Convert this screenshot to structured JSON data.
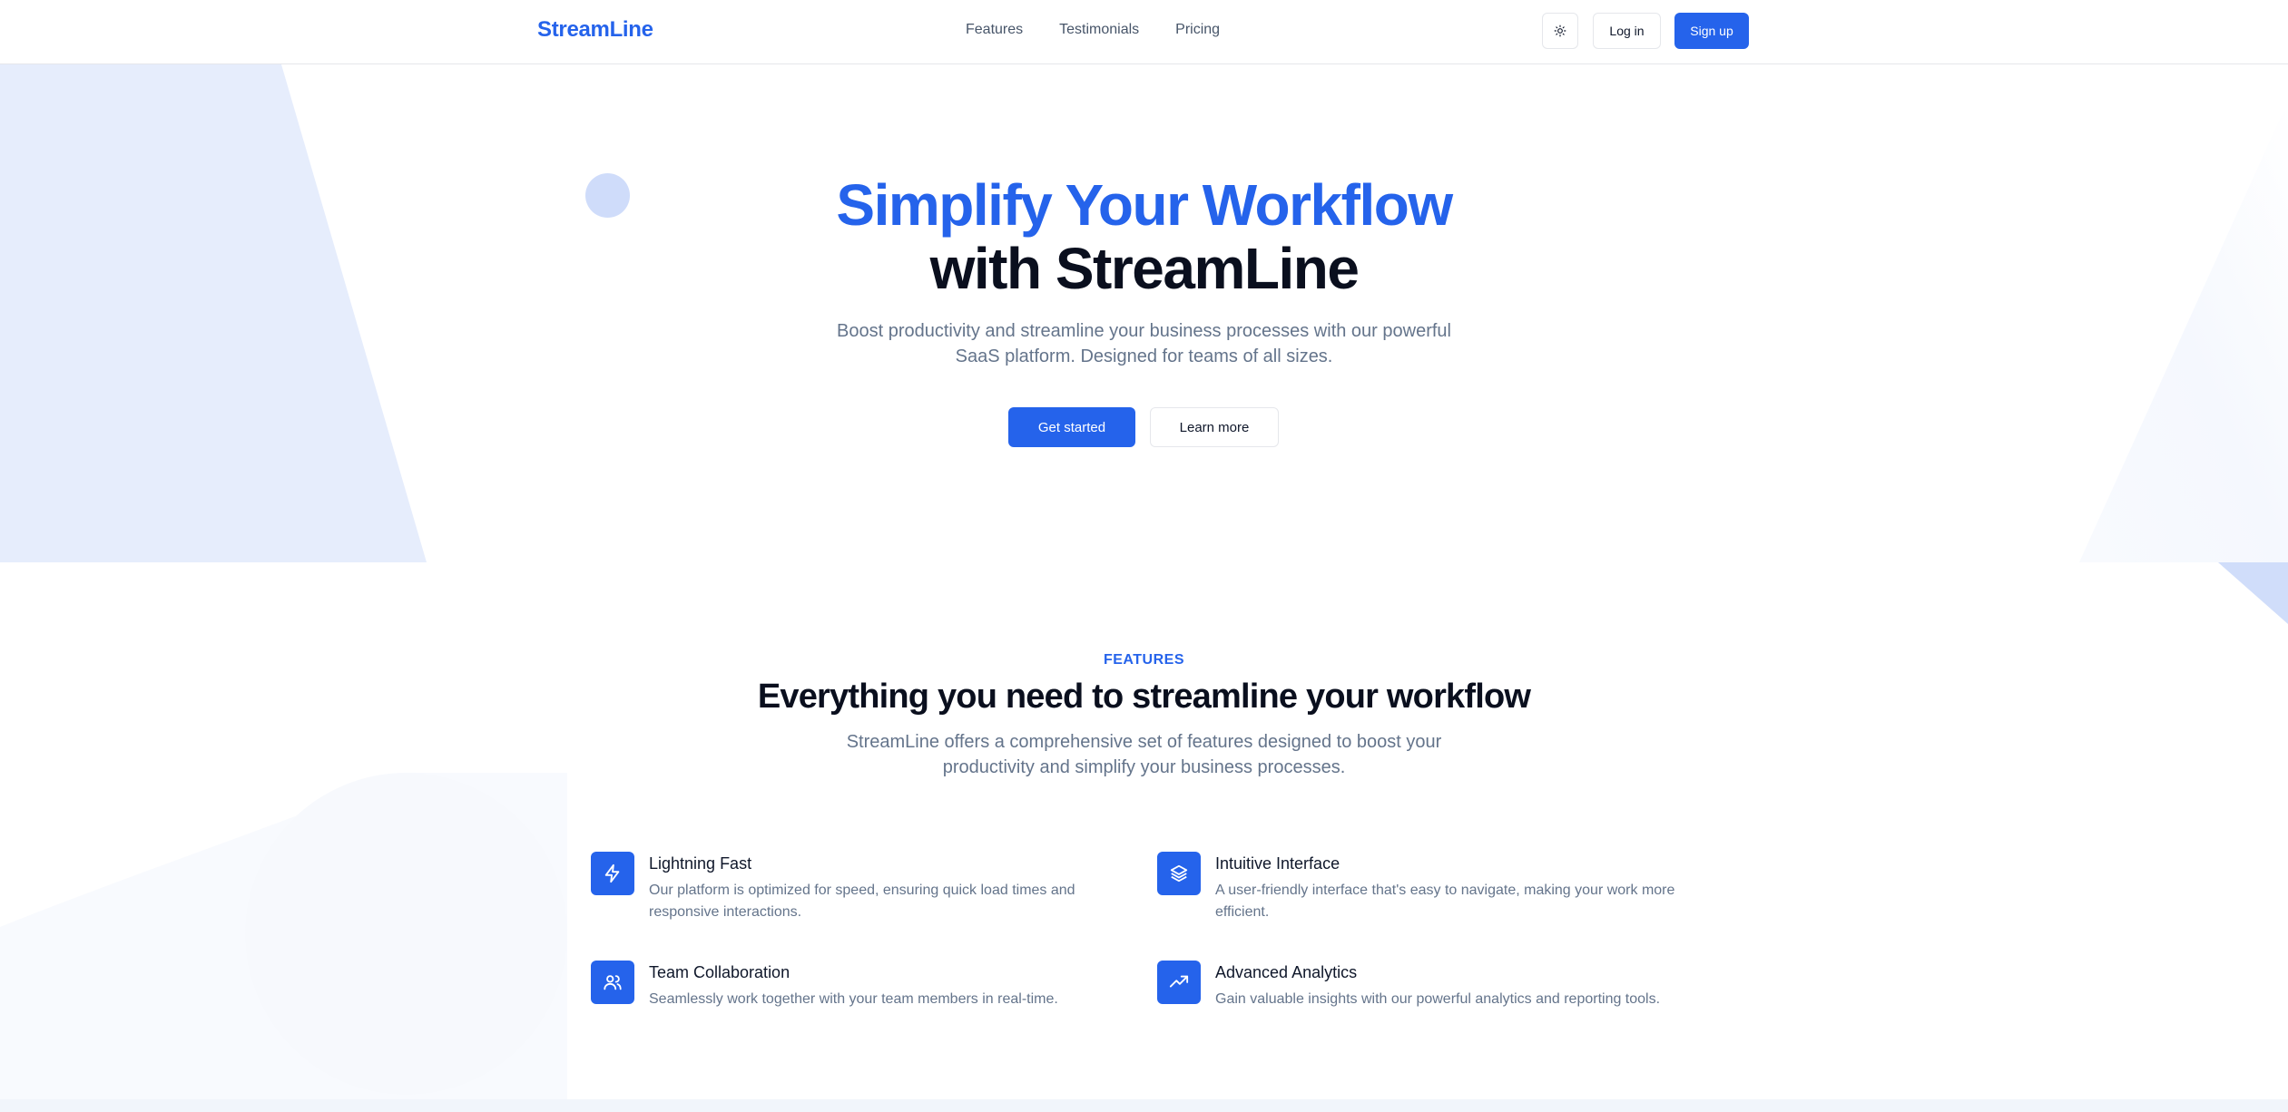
{
  "header": {
    "logo": "StreamLine",
    "nav": [
      "Features",
      "Testimonials",
      "Pricing"
    ],
    "theme_toggle_icon": "sun-icon",
    "login_label": "Log in",
    "signup_label": "Sign up"
  },
  "hero": {
    "title_line1": "Simplify Your Workflow",
    "title_line2": "with StreamLine",
    "subtitle": "Boost productivity and streamline your business processes with our powerful SaaS platform. Designed for teams of all sizes.",
    "primary_cta": "Get started",
    "secondary_cta": "Learn more"
  },
  "features": {
    "eyebrow": "FEATURES",
    "title": "Everything you need to streamline your workflow",
    "subtitle": "StreamLine offers a comprehensive set of features designed to boost your productivity and simplify your business processes.",
    "items": [
      {
        "icon": "lightning-icon",
        "title": "Lightning Fast",
        "description": "Our platform is optimized for speed, ensuring quick load times and responsive interactions."
      },
      {
        "icon": "layers-icon",
        "title": "Intuitive Interface",
        "description": "A user-friendly interface that's easy to navigate, making your work more efficient."
      },
      {
        "icon": "users-icon",
        "title": "Team Collaboration",
        "description": "Seamlessly work together with your team members in real-time."
      },
      {
        "icon": "trending-up-icon",
        "title": "Advanced Analytics",
        "description": "Gain valuable insights with our powerful analytics and reporting tools."
      }
    ]
  },
  "colors": {
    "brand": "#2563eb",
    "heading": "#0a0f1e",
    "muted_text": "#64748b",
    "hero_shape": "#e6edfc"
  }
}
